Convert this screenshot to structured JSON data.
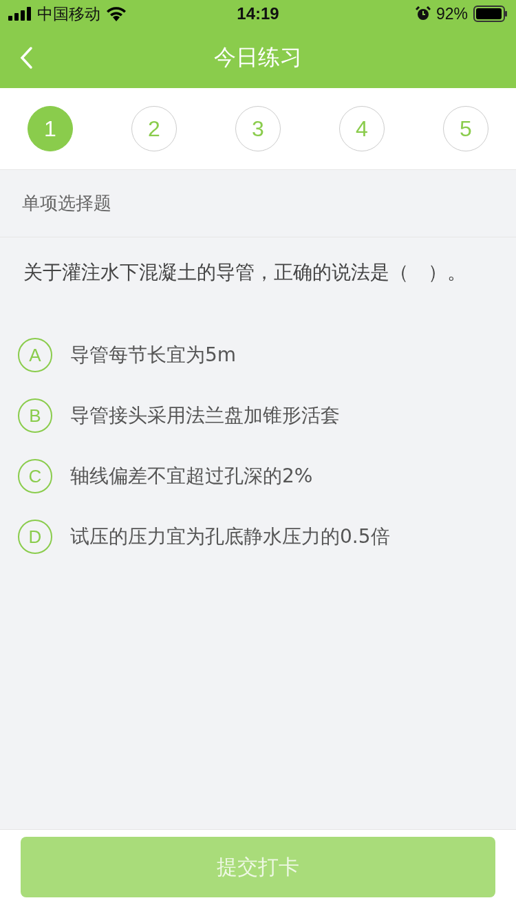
{
  "status_bar": {
    "carrier": "中国移动",
    "time": "14:19",
    "battery": "92%"
  },
  "nav": {
    "title": "今日练习"
  },
  "question_tabs": [
    {
      "label": "1",
      "selected": true
    },
    {
      "label": "2",
      "selected": false
    },
    {
      "label": "3",
      "selected": false
    },
    {
      "label": "4",
      "selected": false
    },
    {
      "label": "5",
      "selected": false
    }
  ],
  "question_type": "单项选择题",
  "question": "关于灌注水下混凝土的导管，正确的说法是（　）。",
  "options": [
    {
      "letter": "A",
      "text": "导管每节长宜为5m",
      "selected": false
    },
    {
      "letter": "B",
      "text": "导管接头采用法兰盘加锥形活套",
      "selected": false
    },
    {
      "letter": "C",
      "text": "轴线偏差不宜超过孔深的2%",
      "selected": false
    },
    {
      "letter": "D",
      "text": "试压的压力宜为孔底静水压力的0.5倍",
      "selected": false
    }
  ],
  "submit": {
    "label": "提交打卡",
    "disabled": true
  }
}
